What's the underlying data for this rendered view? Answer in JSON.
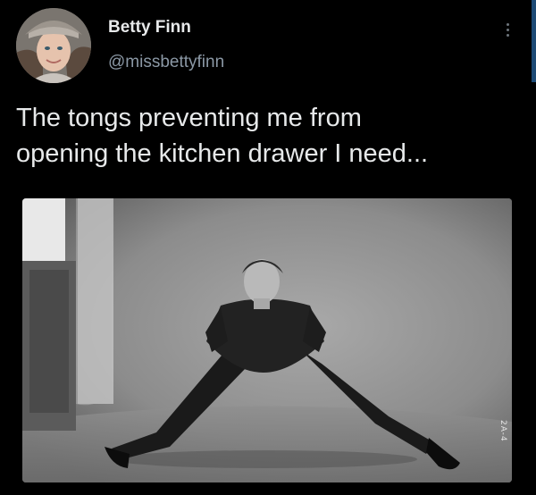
{
  "author": {
    "name": "Betty Finn",
    "handle": "@missbettyfinn"
  },
  "tweet": {
    "line1": "The tongs preventing me from",
    "line2": "opening the kitchen drawer I need..."
  },
  "media": {
    "alt": "Black and white photo of a man in a wide-legged stretching stance in a studio",
    "photo_caption": "2A-4"
  },
  "icons": {
    "more": "more-options-icon"
  },
  "colors": {
    "background": "#000000",
    "text": "#e7e9ea",
    "muted": "#8b98a5"
  }
}
